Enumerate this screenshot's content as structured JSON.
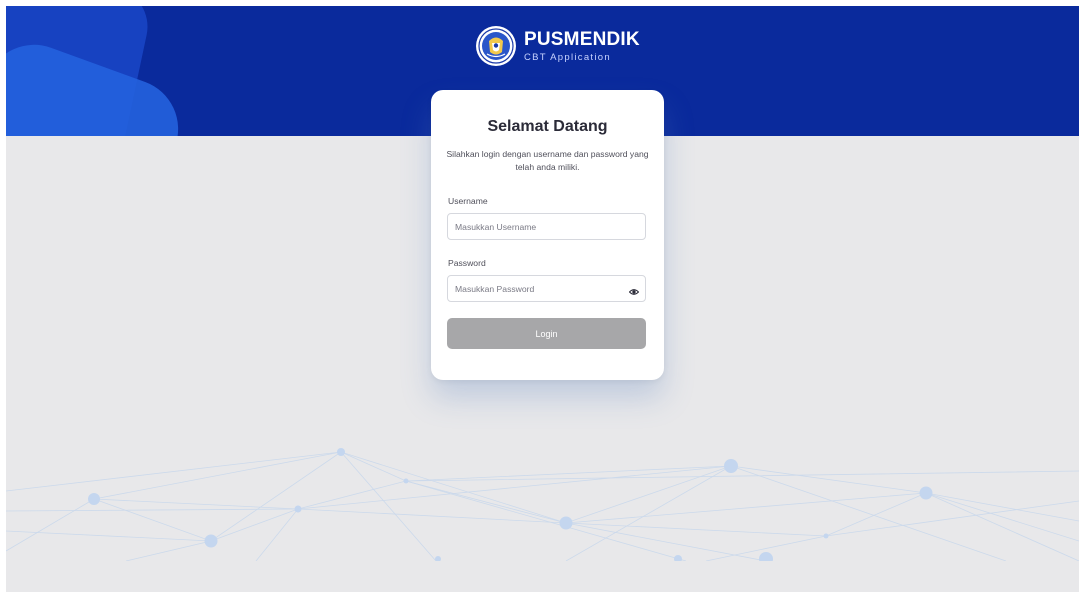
{
  "brand": {
    "name": "PUSMENDIK",
    "subtitle": "CBT Application",
    "logo_icon": "tut-wuri-handayani-emblem-icon"
  },
  "colors": {
    "header_bg": "#0a2a9c",
    "page_bg": "#e8e8ea",
    "button_disabled": "#a7a7a9"
  },
  "login": {
    "title": "Selamat Datang",
    "description": "Silahkan login dengan username dan password yang telah anda miliki.",
    "username_label": "Username",
    "username_placeholder": "Masukkan Username",
    "username_value": "",
    "password_label": "Password",
    "password_placeholder": "Masukkan Password",
    "password_value": "",
    "password_toggle_icon": "eye-icon",
    "submit_label": "Login",
    "submit_enabled": false
  }
}
